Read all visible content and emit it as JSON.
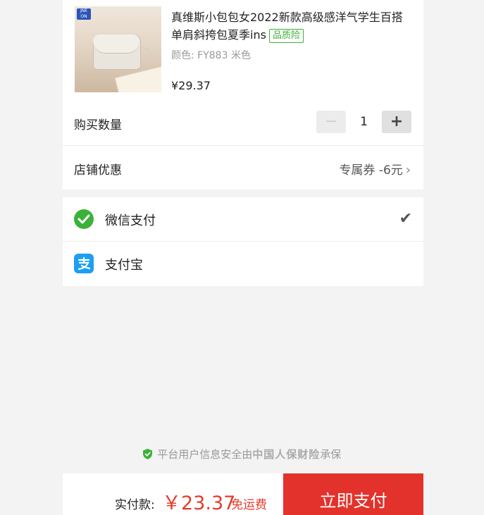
{
  "product": {
    "title": "真维斯小包包女2022新款高级感洋气学生百搭单肩斜挎包夏季ins",
    "badge": "品质险",
    "variant": "颜色: FY883 米色",
    "price": "¥29.37",
    "store_logo": "JNE ON"
  },
  "quantity": {
    "label": "购买数量",
    "minus": "−",
    "plus": "+",
    "value": "1"
  },
  "shop_discount": {
    "label": "店铺优惠",
    "value": "专属券 -6元",
    "chevron": "›"
  },
  "payment_methods": [
    {
      "label": "微信支付",
      "icon": "wechat-pay-icon",
      "selected": true,
      "check": "✔"
    },
    {
      "label": "支付宝",
      "icon": "alipay-icon",
      "selected": false
    }
  ],
  "safety_notice": {
    "shield": "shield-check-icon",
    "text_before": "平台用户信息安全由",
    "insurer": "中国人保财险",
    "text_after": "承保"
  },
  "footer": {
    "total_label": "实付款:",
    "total_amount": "￥23.37",
    "free_shipping": "免运费",
    "pay_button": "立即支付"
  },
  "colors": {
    "accent_red": "#e3322b",
    "price_red": "#e53b2c",
    "wechat_green": "#3cb13a",
    "alipay_blue": "#1c9ff0",
    "badge_green": "#3fae3b"
  }
}
